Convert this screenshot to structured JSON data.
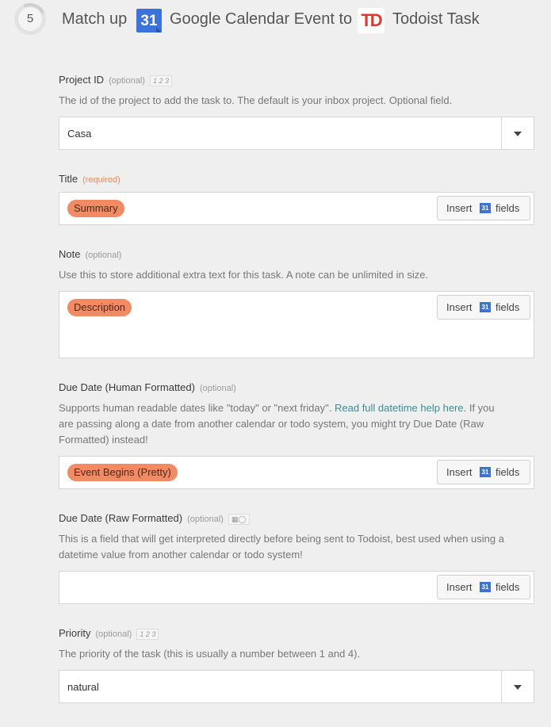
{
  "header": {
    "step_number": "5",
    "match_up": "Match up",
    "trigger_app_icon": "google-calendar-icon",
    "trigger_app_icon_text": "31",
    "trigger_label": "Google Calendar Event to",
    "action_app_icon": "todoist-icon",
    "action_app_icon_text": "TD",
    "action_label": "Todoist Task"
  },
  "insert_button": {
    "insert": "Insert",
    "fields": "fields",
    "icon": "google-calendar-icon",
    "icon_text": "31"
  },
  "fields": {
    "project_id": {
      "label": "Project ID",
      "qualifier": "(optional)",
      "badge": "1 2 3",
      "help": "The id of the project to add the task to. The default is your inbox project. Optional field.",
      "value": "Casa"
    },
    "title": {
      "label": "Title",
      "qualifier": "(required)",
      "pill": "Summary"
    },
    "note": {
      "label": "Note",
      "qualifier": "(optional)",
      "help": "Use this to store additional extra text for this task. A note can be unlimited in size.",
      "pill": "Description"
    },
    "due_date_human": {
      "label": "Due Date (Human Formatted)",
      "qualifier": "(optional)",
      "help_1": "Supports human readable dates like \"today\" or \"next friday\".",
      "help_link": "Read full datetime help here.",
      "help_2": "If you",
      "help_line2": "are passing along a date from another calendar or todo system, you might try Due Date (Raw",
      "help_line3": "Formatted) instead!",
      "pill": "Event Begins (Pretty)"
    },
    "due_date_raw": {
      "label": "Due Date (Raw Formatted)",
      "qualifier": "(optional)",
      "badge_icon": "calendar-clock-icon",
      "help_line1": "This is a field that will get interpreted directly before being sent to Todoist, best used when using a",
      "help_line2": "datetime value from another calendar or todo system!"
    },
    "priority": {
      "label": "Priority",
      "qualifier": "(optional)",
      "badge": "1 2 3",
      "help": "The priority of the task (this is usually a number between 1 and 4).",
      "value": "natural"
    }
  },
  "colors": {
    "pill": "#f28a63",
    "link": "#3e8c95",
    "required": "#e88a5a",
    "gcal": "#3a73dc",
    "todoist": "#dd3b2e"
  }
}
